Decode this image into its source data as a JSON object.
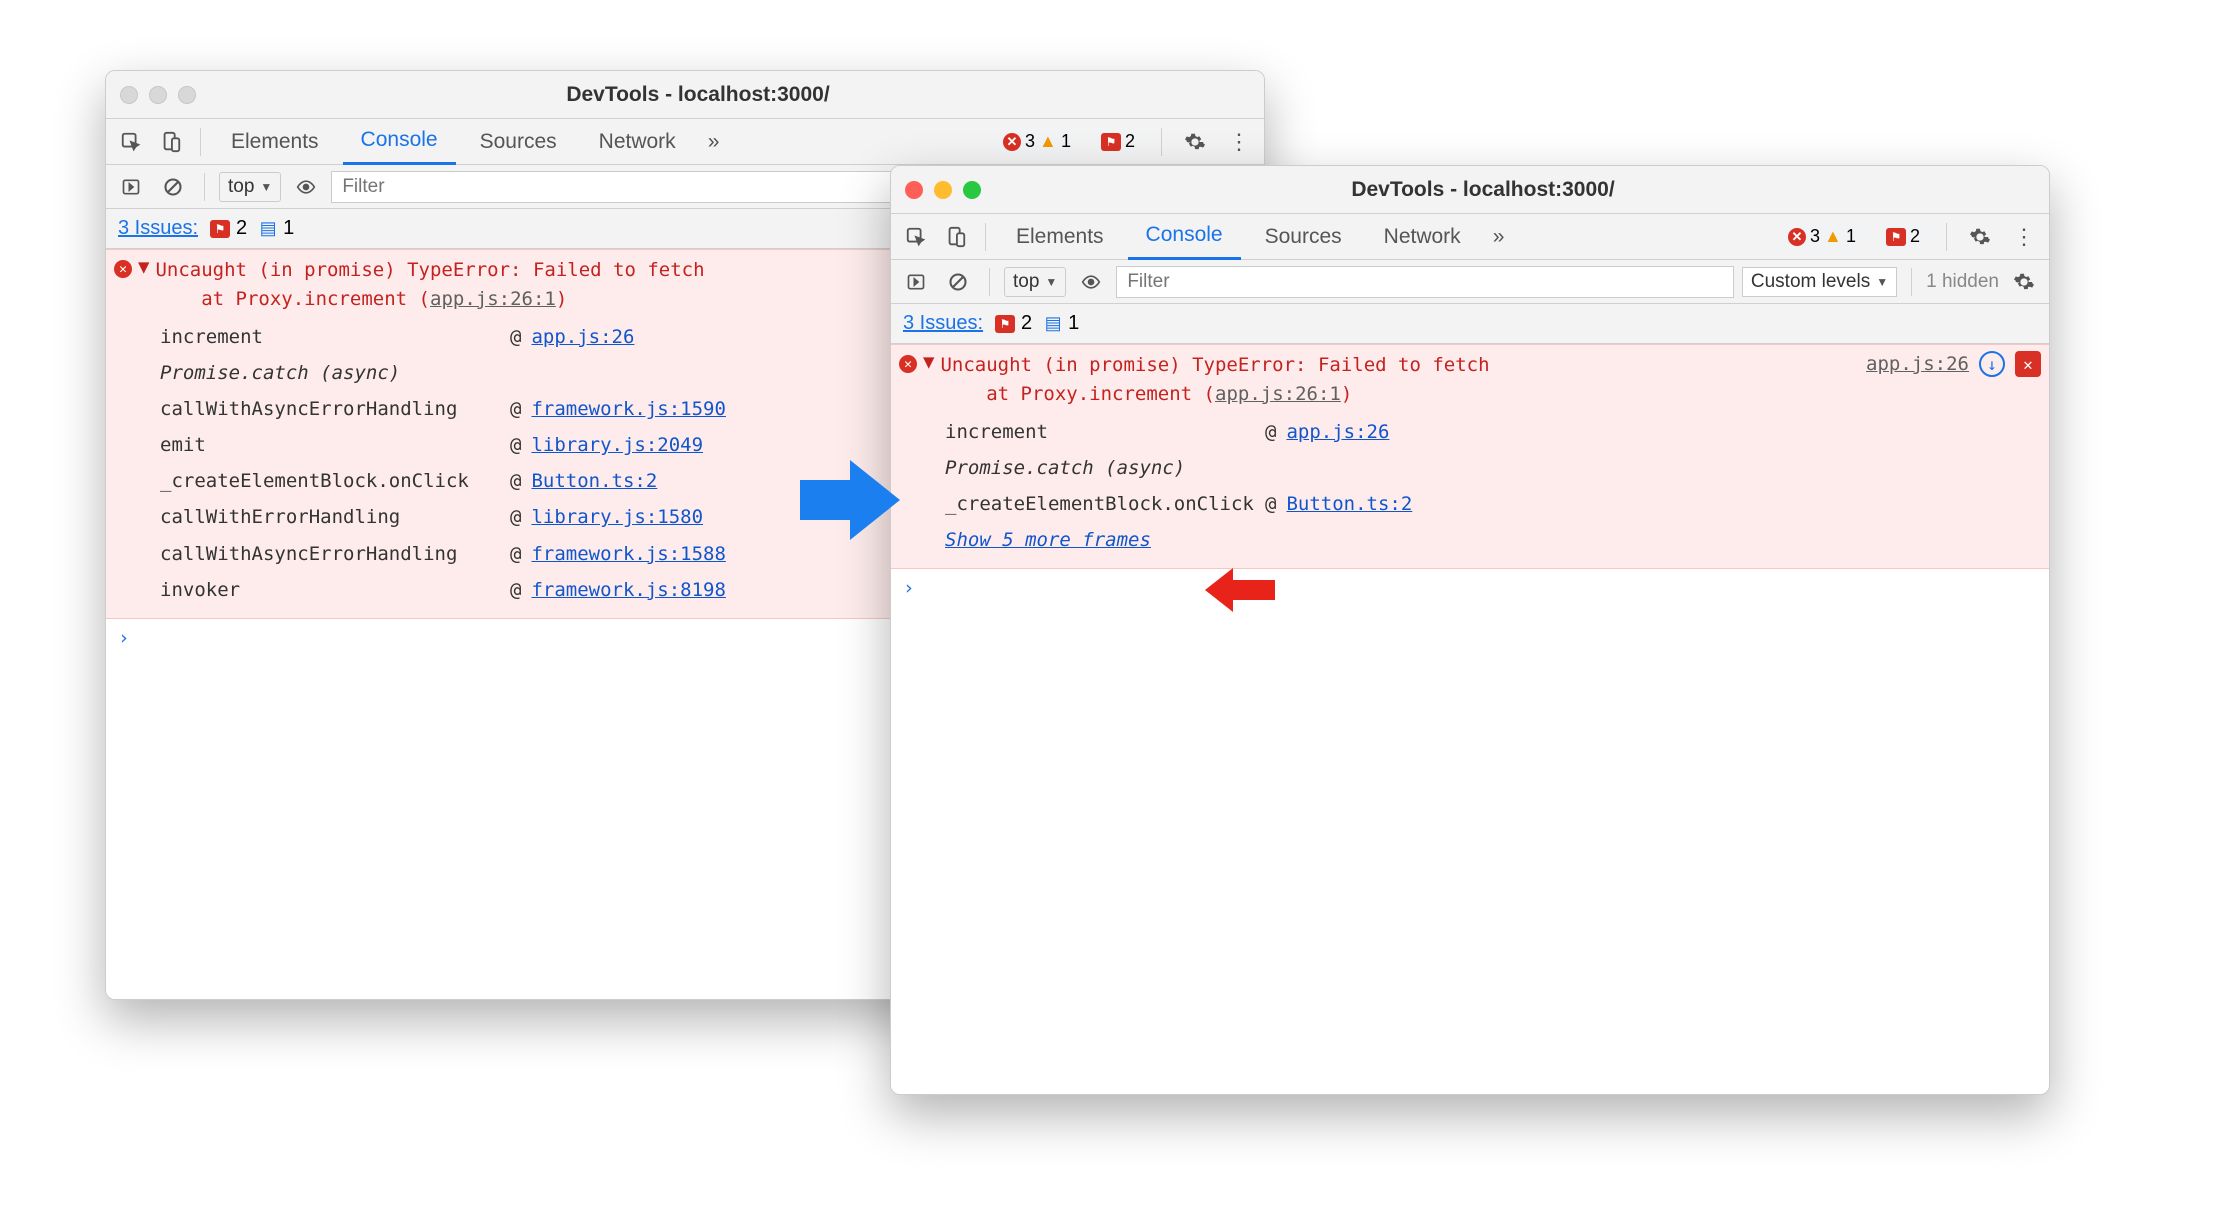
{
  "colors": {
    "accent": "#1a73e8",
    "error": "#d93025",
    "errorBg": "#fdeceb",
    "link": "#1155cc"
  },
  "left": {
    "traffic_style": "grey",
    "title": "DevTools - localhost:3000/",
    "tabs": [
      "Elements",
      "Console",
      "Sources",
      "Network"
    ],
    "active_tab": "Console",
    "overflow": "»",
    "counters": {
      "errors": "3",
      "warnings": "1",
      "flags": "2"
    },
    "toolbar": {
      "context": "top",
      "filter_placeholder": "Filter"
    },
    "issues": {
      "label": "3 Issues:",
      "flags": "2",
      "messages": "1"
    },
    "error": {
      "line1": "Uncaught (in promise) TypeError: Failed to fetch",
      "line2_prefix": "    at Proxy.increment (",
      "line2_link": "app.js:26:1",
      "line2_suffix": ")",
      "frames": [
        {
          "fn": "increment",
          "at": "@",
          "link": "app.js:26"
        },
        {
          "async": "Promise.catch (async)"
        },
        {
          "fn": "callWithAsyncErrorHandling",
          "at": "@",
          "link": "framework.js:1590"
        },
        {
          "fn": "emit",
          "at": "@",
          "link": "library.js:2049"
        },
        {
          "fn": "_createElementBlock.onClick",
          "at": "@",
          "link": "Button.ts:2"
        },
        {
          "fn": "callWithErrorHandling",
          "at": "@",
          "link": "library.js:1580"
        },
        {
          "fn": "callWithAsyncErrorHandling",
          "at": "@",
          "link": "framework.js:1588"
        },
        {
          "fn": "invoker",
          "at": "@",
          "link": "framework.js:8198"
        }
      ]
    },
    "prompt": "›"
  },
  "right": {
    "traffic_style": "color",
    "title": "DevTools - localhost:3000/",
    "tabs": [
      "Elements",
      "Console",
      "Sources",
      "Network"
    ],
    "active_tab": "Console",
    "overflow": "»",
    "counters": {
      "errors": "3",
      "warnings": "1",
      "flags": "2"
    },
    "toolbar": {
      "context": "top",
      "filter_placeholder": "Filter",
      "levels": "Custom levels",
      "hidden": "1 hidden"
    },
    "issues": {
      "label": "3 Issues:",
      "flags": "2",
      "messages": "1"
    },
    "error": {
      "line1": "Uncaught (in promise) TypeError: Failed to fetch",
      "line2_prefix": "    at Proxy.increment (",
      "line2_link": "app.js:26:1",
      "line2_suffix": ")",
      "source_link": "app.js:26",
      "frames": [
        {
          "fn": "increment",
          "at": "@",
          "link": "app.js:26"
        },
        {
          "async": "Promise.catch (async)"
        },
        {
          "fn": "_createElementBlock.onClick",
          "at": "@",
          "link": "Button.ts:2"
        }
      ],
      "show_more": "Show 5 more frames"
    },
    "prompt": "›"
  }
}
